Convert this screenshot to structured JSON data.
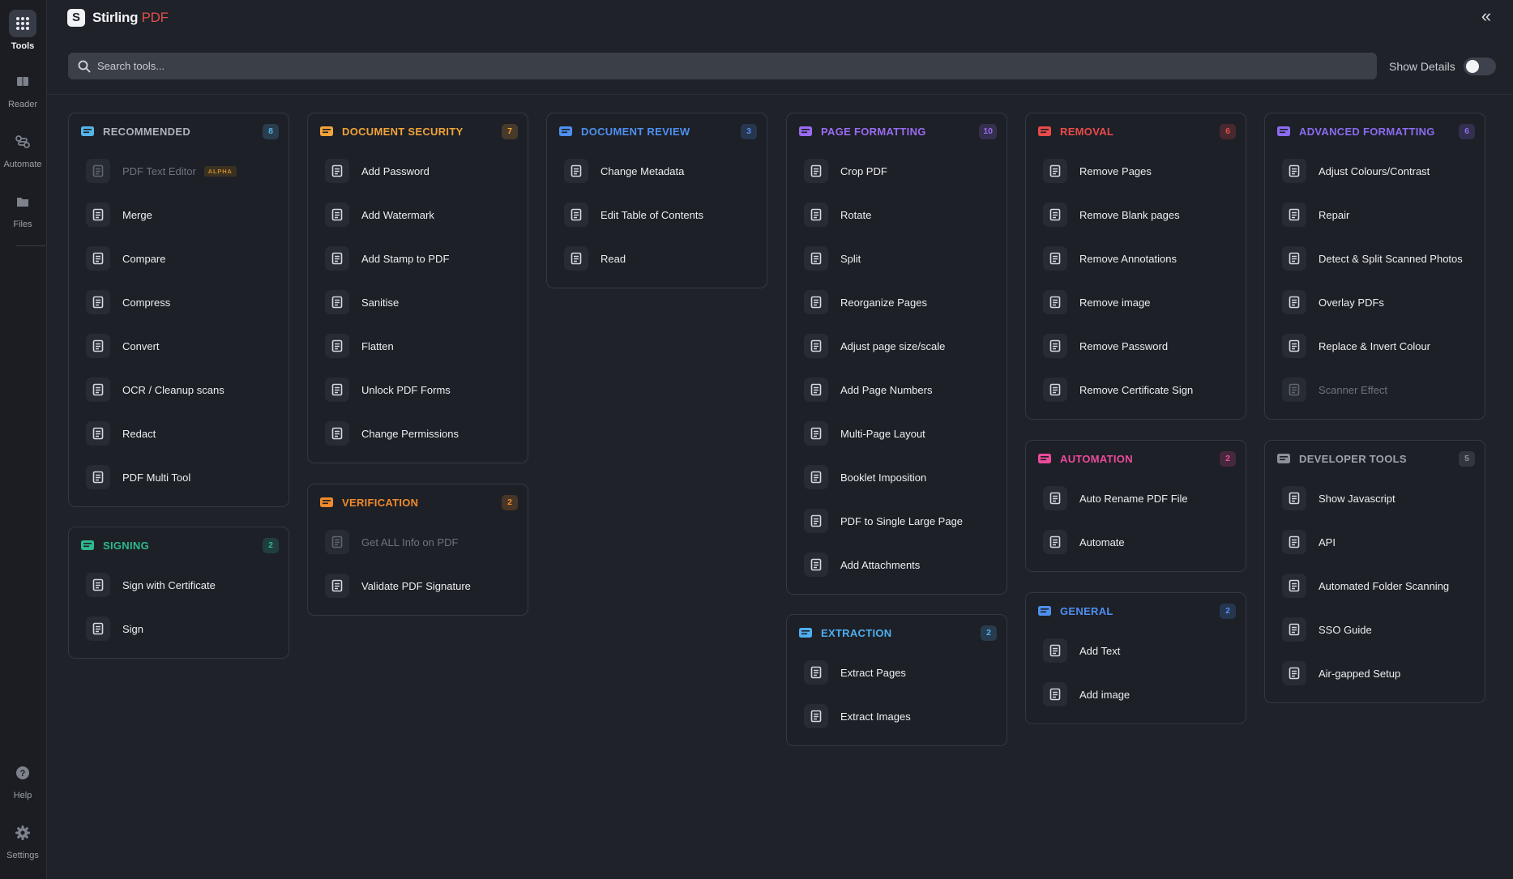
{
  "app": {
    "brand": "Stirling",
    "brand_suffix": "PDF",
    "logo_letter": "S",
    "collapse_icon": "double-chevron-left-icon"
  },
  "rail": {
    "items": [
      {
        "label": "Tools",
        "icon": "grid-icon",
        "active": true
      },
      {
        "label": "Reader",
        "icon": "book-icon",
        "active": false
      },
      {
        "label": "Automate",
        "icon": "automate-icon",
        "active": false
      },
      {
        "label": "Files",
        "icon": "folder-icon",
        "active": false
      },
      {
        "label": "Help",
        "icon": "help-icon",
        "active": false
      },
      {
        "label": "Settings",
        "icon": "gear-icon",
        "active": false
      }
    ]
  },
  "search": {
    "placeholder": "Search tools...",
    "value": ""
  },
  "details": {
    "label": "Show Details",
    "on": false
  },
  "colors": {
    "recommended": "#55b4e9",
    "document_security": "#f2a33a",
    "document_review": "#4f8ff0",
    "page_formatting": "#9a6cf0",
    "removal": "#ea4a4a",
    "advanced_formatting": "#8b6cf0",
    "signing": "#2fb88f",
    "verification": "#f08a2c",
    "automation": "#ec4a9a",
    "developer_tools": "#8b909a",
    "extraction": "#4eaef0",
    "general": "#4f8ff0"
  },
  "categories": [
    {
      "key": "recommended",
      "title": "RECOMMENDED",
      "count": "8",
      "icon": "thumbs-up-icon",
      "title_color": "#aeb2ba",
      "tools": [
        {
          "label": "PDF Text Editor",
          "badge": "ALPHA",
          "icon": "edit-text-icon",
          "dim": true
        },
        {
          "label": "Merge",
          "icon": "merge-icon"
        },
        {
          "label": "Compare",
          "icon": "compare-icon"
        },
        {
          "label": "Compress",
          "icon": "compress-icon"
        },
        {
          "label": "Convert",
          "icon": "convert-icon"
        },
        {
          "label": "OCR / Cleanup scans",
          "icon": "ocr-icon"
        },
        {
          "label": "Redact",
          "icon": "redact-icon"
        },
        {
          "label": "PDF Multi Tool",
          "icon": "multi-tool-icon"
        }
      ]
    },
    {
      "key": "signing",
      "title": "SIGNING",
      "count": "2",
      "icon": "signing-icon",
      "tools": [
        {
          "label": "Sign with Certificate",
          "icon": "certificate-icon"
        },
        {
          "label": "Sign",
          "icon": "signature-icon"
        }
      ]
    },
    {
      "key": "document_security",
      "title": "DOCUMENT SECURITY",
      "count": "7",
      "icon": "shield-icon",
      "tools": [
        {
          "label": "Add Password",
          "icon": "password-dots-icon"
        },
        {
          "label": "Add Watermark",
          "icon": "watermark-icon"
        },
        {
          "label": "Add Stamp to PDF",
          "icon": "stamp-icon"
        },
        {
          "label": "Sanitise",
          "icon": "sanitise-icon"
        },
        {
          "label": "Flatten",
          "icon": "flatten-icon"
        },
        {
          "label": "Unlock PDF Forms",
          "icon": "unlock-forms-icon"
        },
        {
          "label": "Change Permissions",
          "icon": "lock-icon"
        }
      ]
    },
    {
      "key": "verification",
      "title": "VERIFICATION",
      "count": "2",
      "icon": "verified-shield-icon",
      "tools": [
        {
          "label": "Get ALL Info on PDF",
          "icon": "info-icon",
          "dim": true
        },
        {
          "label": "Validate PDF Signature",
          "icon": "validate-icon"
        }
      ]
    },
    {
      "key": "document_review",
      "title": "DOCUMENT REVIEW",
      "count": "3",
      "icon": "review-icon",
      "tools": [
        {
          "label": "Change Metadata",
          "icon": "metadata-icon"
        },
        {
          "label": "Edit Table of Contents",
          "icon": "toc-icon"
        },
        {
          "label": "Read",
          "icon": "read-icon"
        }
      ]
    },
    {
      "key": "page_formatting",
      "title": "PAGE FORMATTING",
      "count": "10",
      "icon": "page-format-icon",
      "tools": [
        {
          "label": "Crop PDF",
          "icon": "crop-icon"
        },
        {
          "label": "Rotate",
          "icon": "rotate-icon"
        },
        {
          "label": "Split",
          "icon": "scissors-icon"
        },
        {
          "label": "Reorganize Pages",
          "icon": "reorganize-icon"
        },
        {
          "label": "Adjust page size/scale",
          "icon": "scale-icon"
        },
        {
          "label": "Add Page Numbers",
          "icon": "page-numbers-icon"
        },
        {
          "label": "Multi-Page Layout",
          "icon": "layout-icon"
        },
        {
          "label": "Booklet Imposition",
          "icon": "booklet-icon"
        },
        {
          "label": "PDF to Single Large Page",
          "icon": "single-page-icon"
        },
        {
          "label": "Add Attachments",
          "icon": "attachment-icon"
        }
      ]
    },
    {
      "key": "extraction",
      "title": "EXTRACTION",
      "count": "2",
      "icon": "download-icon",
      "tools": [
        {
          "label": "Extract Pages",
          "icon": "upload-icon"
        },
        {
          "label": "Extract Images",
          "icon": "images-icon"
        }
      ]
    },
    {
      "key": "removal",
      "title": "REMOVAL",
      "count": "6",
      "icon": "removal-icon",
      "tools": [
        {
          "label": "Remove Pages",
          "icon": "trash-icon"
        },
        {
          "label": "Remove Blank pages",
          "icon": "blank-page-icon"
        },
        {
          "label": "Remove Annotations",
          "icon": "annotation-off-icon"
        },
        {
          "label": "Remove image",
          "icon": "image-off-icon"
        },
        {
          "label": "Remove Password",
          "icon": "unlock-icon"
        },
        {
          "label": "Remove Certificate Sign",
          "icon": "cert-off-icon"
        }
      ]
    },
    {
      "key": "automation",
      "title": "AUTOMATION",
      "count": "2",
      "icon": "robot-icon",
      "tools": [
        {
          "label": "Auto Rename PDF File",
          "icon": "rename-icon"
        },
        {
          "label": "Automate",
          "icon": "automate-icon"
        }
      ]
    },
    {
      "key": "general",
      "title": "GENERAL",
      "count": "2",
      "icon": "wrench-icon",
      "tools": [
        {
          "label": "Add Text",
          "icon": "text-icon"
        },
        {
          "label": "Add image",
          "icon": "image-icon"
        }
      ]
    },
    {
      "key": "advanced_formatting",
      "title": "ADVANCED FORMATTING",
      "count": "6",
      "icon": "sliders-icon",
      "tools": [
        {
          "label": "Adjust Colours/Contrast",
          "icon": "palette-icon"
        },
        {
          "label": "Repair",
          "icon": "repair-icon"
        },
        {
          "label": "Detect & Split Scanned Photos",
          "icon": "scan-photos-icon"
        },
        {
          "label": "Overlay PDFs",
          "icon": "layers-icon"
        },
        {
          "label": "Replace & Invert Colour",
          "icon": "paint-bucket-icon"
        },
        {
          "label": "Scanner Effect",
          "icon": "scanner-icon",
          "dim": true
        }
      ]
    },
    {
      "key": "developer_tools",
      "title": "DEVELOPER TOOLS",
      "count": "5",
      "icon": "code-icon",
      "title_color": "#9ea3ac",
      "tools": [
        {
          "label": "Show Javascript",
          "icon": "js-icon"
        },
        {
          "label": "API",
          "icon": "external-link-icon"
        },
        {
          "label": "Automated Folder Scanning",
          "icon": "external-link-icon"
        },
        {
          "label": "SSO Guide",
          "icon": "external-link-icon"
        },
        {
          "label": "Air-gapped Setup",
          "icon": "external-link-icon"
        }
      ]
    }
  ]
}
